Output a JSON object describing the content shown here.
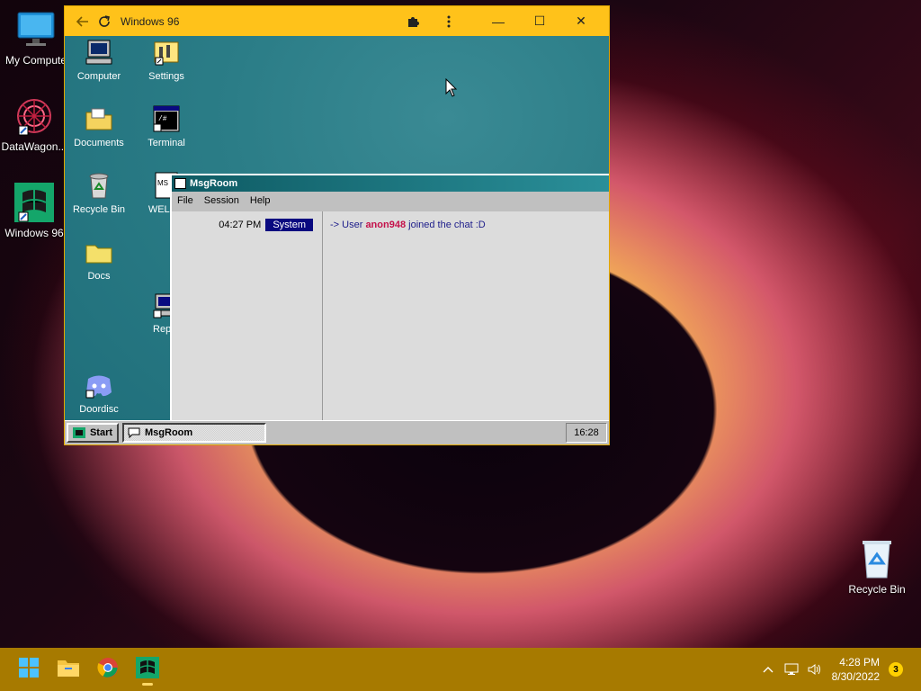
{
  "desktop": {
    "icons": [
      {
        "label": "My Compute"
      },
      {
        "label": "DataWagon..."
      },
      {
        "label": "Windows 96"
      },
      {
        "label": "Recycle Bin"
      }
    ]
  },
  "browser": {
    "title": "Windows 96",
    "controls": {
      "minimize": "—",
      "maximize": "☐",
      "close": "✕"
    }
  },
  "win96": {
    "icons": [
      {
        "label": "Computer"
      },
      {
        "label": "Settings"
      },
      {
        "label": "Documents"
      },
      {
        "label": "Terminal"
      },
      {
        "label": "Recycle Bin"
      },
      {
        "label": "WELCO"
      },
      {
        "label": "Docs"
      },
      {
        "label": "Repor"
      },
      {
        "label": "Doordisc"
      }
    ],
    "msgroom": {
      "title": "MsgRoom",
      "menu": [
        "File",
        "Session",
        "Help"
      ],
      "messages": [
        {
          "time": "04:27 PM",
          "sender": "System",
          "prefix": "-> User",
          "user": "anon948",
          "suffix": "joined the chat :D"
        }
      ]
    },
    "taskbar": {
      "start": "Start",
      "task": "MsgRoom",
      "clock": "16:28"
    }
  },
  "taskbar": {
    "time": "4:28 PM",
    "date": "8/30/2022",
    "notifications": "3"
  },
  "colors": {
    "browser_frame": "#ffc21a",
    "win11_taskbar": "#a77a00",
    "msgroom_system_badge": "#0a0a80",
    "msgroom_user": "#c4114a"
  }
}
